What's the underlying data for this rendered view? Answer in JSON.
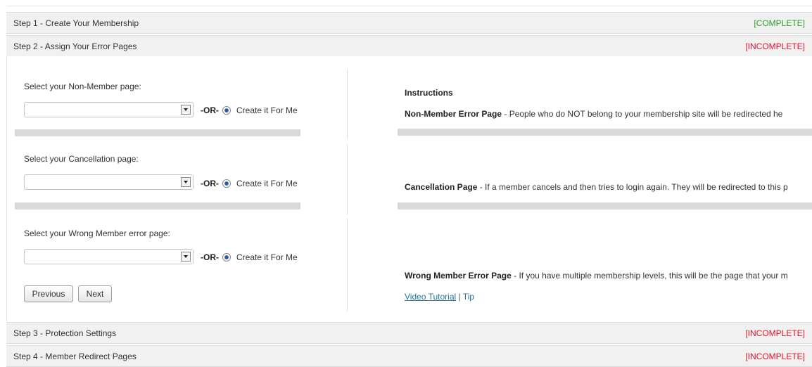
{
  "steps": [
    {
      "title": "Step 1 - Create Your Membership",
      "status": "[COMPLETE]"
    },
    {
      "title": "Step 2 - Assign Your Error Pages",
      "status": "[INCOMPLETE]"
    },
    {
      "title": "Step 3 - Protection Settings",
      "status": "[INCOMPLETE]"
    },
    {
      "title": "Step 4 - Member Redirect Pages",
      "status": "[INCOMPLETE]"
    }
  ],
  "form": {
    "non_member": {
      "label": "Select your Non-Member page:",
      "value": "",
      "or": "-OR-",
      "option": "Create it For Me"
    },
    "cancellation": {
      "label": "Select your Cancellation page:",
      "value": "",
      "or": "-OR-",
      "option": "Create it For Me"
    },
    "wrong_member": {
      "label": "Select your Wrong Member error page:",
      "value": "",
      "or": "-OR-",
      "option": "Create it For Me"
    }
  },
  "buttons": {
    "previous": "Previous",
    "next": "Next"
  },
  "instructions": {
    "title": "Instructions",
    "non_member": {
      "heading": "Non-Member Error Page",
      "text": " - People who do NOT belong to your membership site will be redirected he"
    },
    "cancellation": {
      "heading": "Cancellation Page",
      "text": " - If a member cancels and then tries to login again. They will be redirected to this p"
    },
    "wrong_member": {
      "heading": "Wrong Member Error Page",
      "text": " - If you have multiple membership levels, this will be the page that your m"
    }
  },
  "links": {
    "video": "Video Tutorial",
    "separator": " | ",
    "tip": "Tip"
  },
  "colors": {
    "complete": "#2aa02a",
    "incomplete": "#e8112d",
    "link": "#21759b",
    "bar": "#d9d9d9",
    "radio": "#2c5b9b"
  },
  "icons": {
    "select_arrow": "chevron-down-icon",
    "radio": "radio-selected-icon"
  }
}
